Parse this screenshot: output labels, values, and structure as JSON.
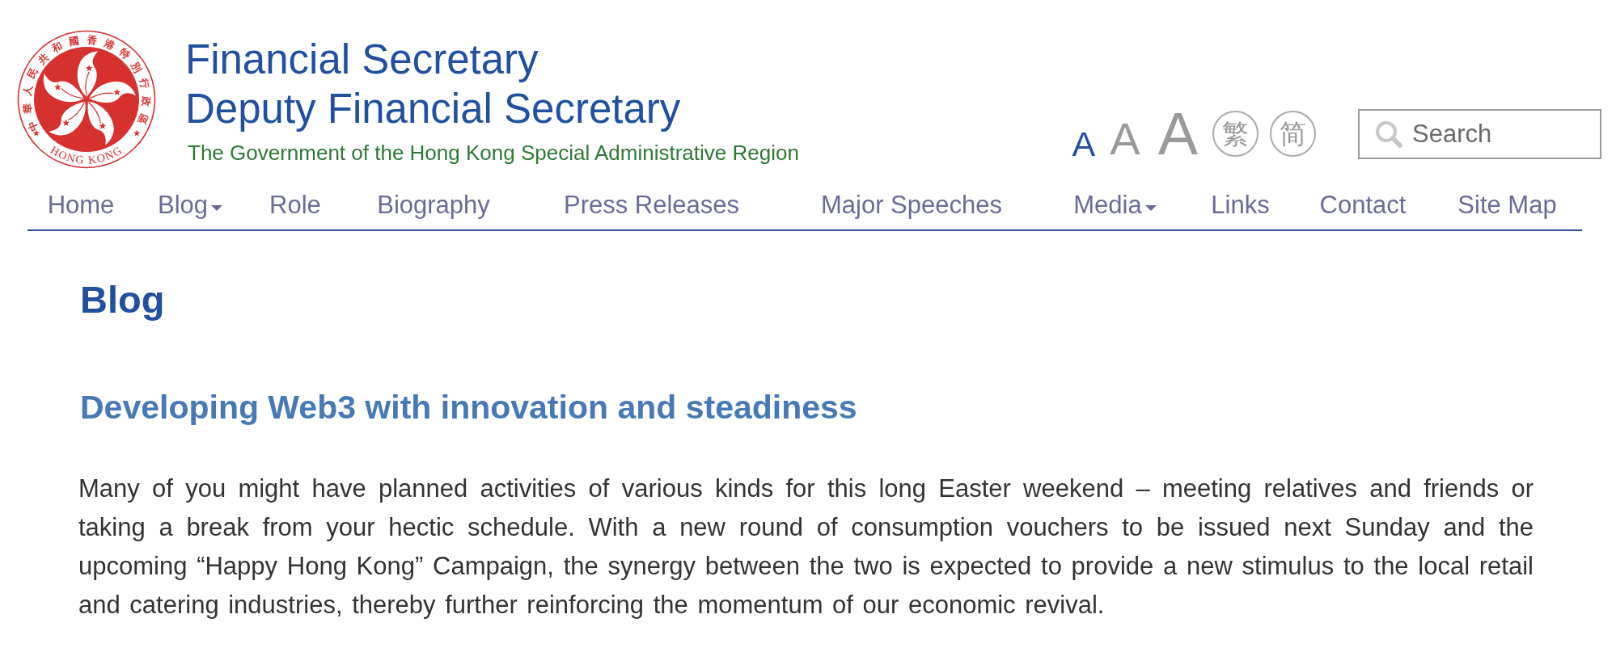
{
  "header": {
    "emblem": {
      "ring_text": "中華人民共和國香港特別行政區",
      "bottom_text": "HONG KONG"
    },
    "titles": [
      "Financial Secretary",
      "Deputy Financial Secretary"
    ],
    "subtitle": "The Government of the Hong Kong Special Administrative Region",
    "font_sizes": [
      {
        "label": "A",
        "kind": "small",
        "selected": true
      },
      {
        "label": "A",
        "kind": "medium",
        "selected": false
      },
      {
        "label": "A",
        "kind": "large",
        "selected": false
      }
    ],
    "languages": [
      {
        "label": "繁"
      },
      {
        "label": "简"
      }
    ],
    "search": {
      "placeholder": "Search"
    }
  },
  "nav": [
    {
      "label": "Home",
      "has_menu": false
    },
    {
      "label": "Blog",
      "has_menu": true
    },
    {
      "label": "Role",
      "has_menu": false
    },
    {
      "label": "Biography",
      "has_menu": false
    },
    {
      "label": "Press Releases",
      "has_menu": false
    },
    {
      "label": "Major Speeches",
      "has_menu": false
    },
    {
      "label": "Media",
      "has_menu": true
    },
    {
      "label": "Links",
      "has_menu": false
    },
    {
      "label": "Contact",
      "has_menu": false
    },
    {
      "label": "Site Map",
      "has_menu": false
    }
  ],
  "page": {
    "heading": "Blog",
    "article": {
      "title": "Developing Web3 with innovation and steadiness",
      "paragraphs": [
        "Many of you might have planned activities of various kinds for this long Easter weekend – meeting relatives and friends or taking a break from your hectic schedule. With a new round of consumption vouchers to be issued next Sunday and the upcoming “Happy Hong Kong” Campaign, the synergy between the two is expected to provide a new stimulus to the local retail and catering industries, thereby further reinforcing the momentum of our economic revival."
      ]
    }
  }
}
